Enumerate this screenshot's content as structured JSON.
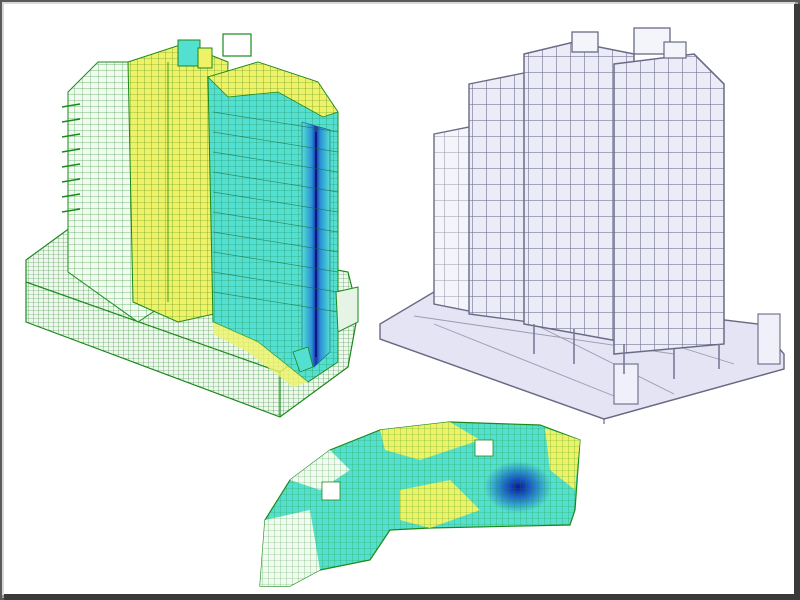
{
  "figure": {
    "panels": [
      {
        "id": "fea-tower",
        "kind": "finite-element stress contour model",
        "colors": [
          "#1b8a1b",
          "#f2f25a",
          "#53e0d0",
          "#2a8fd6",
          "#1a2fb0"
        ]
      },
      {
        "id": "wireframe-tower",
        "kind": "structural wireframe model",
        "colors": [
          "#8a8aa8",
          "#e6e6f6",
          "#c8c8e2"
        ]
      },
      {
        "id": "floor-slab",
        "kind": "floor slab contour plot",
        "colors": [
          "#1b8a1b",
          "#f2f25a",
          "#53e0d0",
          "#2a8fd6",
          "#1a2fb0"
        ]
      }
    ]
  }
}
